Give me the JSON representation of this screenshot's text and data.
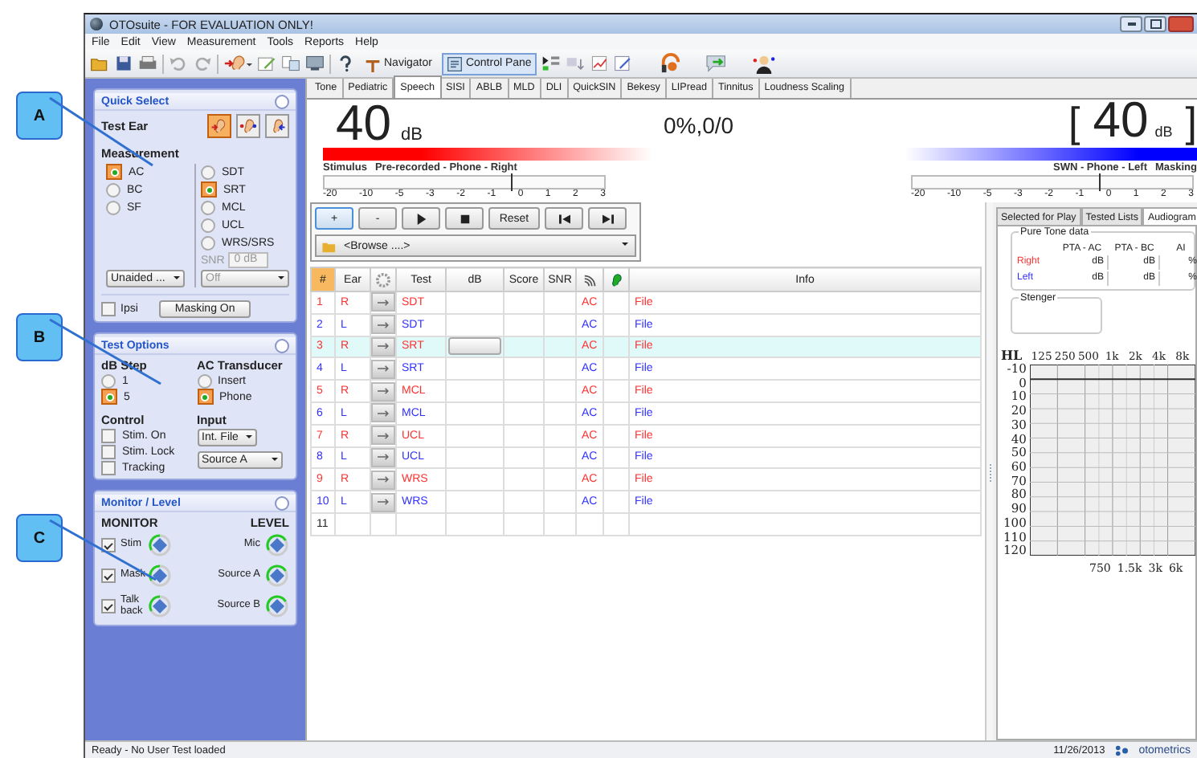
{
  "window": {
    "title": "OTOsuite - FOR EVALUATION ONLY!"
  },
  "menu": [
    "File",
    "Edit",
    "View",
    "Measurement",
    "Tools",
    "Reports",
    "Help"
  ],
  "toolbar": {
    "navigator": "Navigator",
    "control_panel": "Control Pane"
  },
  "callouts": [
    {
      "label": "A"
    },
    {
      "label": "B"
    },
    {
      "label": "C"
    }
  ],
  "quick_select": {
    "title": "Quick Select",
    "test_ear_label": "Test Ear",
    "ear_buttons": [
      {
        "kind": "right",
        "selected": true
      },
      {
        "kind": "both",
        "selected": false
      },
      {
        "kind": "left",
        "selected": false
      }
    ],
    "measurement_label": "Measurement",
    "transducers": [
      {
        "label": "AC",
        "selected": true
      },
      {
        "label": "BC",
        "selected": false
      },
      {
        "label": "SF",
        "selected": false
      }
    ],
    "tests": [
      {
        "label": "SDT",
        "selected": false
      },
      {
        "label": "SRT",
        "selected": true
      },
      {
        "label": "MCL",
        "selected": false
      },
      {
        "label": "UCL",
        "selected": false
      },
      {
        "label": "WRS/SRS",
        "selected": false
      }
    ],
    "snr_label": "SNR",
    "snr_value": "0 dB",
    "snr_mode": "Off",
    "aided": "Unaided ...",
    "ipsi": {
      "label": "Ipsi",
      "checked": false
    },
    "masking_button": "Masking On"
  },
  "test_options": {
    "title": "Test Options",
    "db_step_label": "dB Step",
    "db_steps": [
      {
        "label": "1",
        "selected": false
      },
      {
        "label": "5",
        "selected": true
      }
    ],
    "transducer_label": "AC Transducer",
    "transducers": [
      {
        "label": "Insert",
        "selected": false
      },
      {
        "label": "Phone",
        "selected": true
      }
    ],
    "control_label": "Control",
    "controls": [
      {
        "label": "Stim. On",
        "checked": false
      },
      {
        "label": "Stim. Lock",
        "checked": false
      },
      {
        "label": "Tracking",
        "checked": false
      }
    ],
    "input_label": "Input",
    "input_source": "Int. File",
    "input_channel": "Source A"
  },
  "monitor": {
    "title": "Monitor / Level",
    "monitor_label": "MONITOR",
    "level_label": "LEVEL",
    "monitors": [
      {
        "label": "Stim",
        "checked": true
      },
      {
        "label": "Mask",
        "checked": true
      },
      {
        "label": "Talk back",
        "checked": true
      }
    ],
    "levels": [
      "Mic",
      "Source A",
      "Source B"
    ]
  },
  "test_tabs": [
    {
      "label": "Tone",
      "selected": false
    },
    {
      "label": "Pediatric",
      "selected": false
    },
    {
      "label": "Speech",
      "selected": true
    },
    {
      "label": "SISI",
      "selected": false
    },
    {
      "label": "ABLB",
      "selected": false
    },
    {
      "label": "MLD",
      "selected": false
    },
    {
      "label": "DLI",
      "selected": false
    },
    {
      "label": "QuickSIN",
      "selected": false
    },
    {
      "label": "Bekesy",
      "selected": false
    },
    {
      "label": "LIPread",
      "selected": false
    },
    {
      "label": "Tinnitus",
      "selected": false
    },
    {
      "label": "Loudness Scaling",
      "selected": false
    }
  ],
  "display": {
    "stimulus_level": "40",
    "stimulus_unit": "dB",
    "score": "0%,0/0",
    "bracket_open": "[",
    "masking_level": "40",
    "masking_unit": "dB",
    "bracket_close": "]",
    "stimulus_title": "Stimulus",
    "stimulus_desc": "Pre-recorded - Phone - Right",
    "masking_desc": "SWN - Phone - Left",
    "masking_title": "Masking",
    "stimulus_slider": {
      "level": 0.667
    },
    "masking_slider": {
      "level": 0.667
    },
    "stimulus_scale": [
      "-20",
      "-10",
      "-5",
      "-3",
      "-2",
      "-1",
      "0",
      "1",
      "2",
      "3"
    ],
    "masking_scale": [
      "-20",
      "-10",
      "-5",
      "-3",
      "-2",
      "-1",
      "0",
      "1",
      "2",
      "3"
    ]
  },
  "player": {
    "buttons": [
      {
        "kind": "text",
        "label": "+"
      },
      {
        "kind": "text",
        "label": "-"
      },
      {
        "kind": "play"
      },
      {
        "kind": "stop"
      },
      {
        "kind": "text",
        "label": "Reset"
      },
      {
        "kind": "previous"
      },
      {
        "kind": "next"
      }
    ],
    "browse": "<Browse ....>"
  },
  "table": {
    "columns": [
      {
        "kind": "text",
        "label": "#"
      },
      {
        "kind": "text",
        "label": "Ear"
      },
      {
        "kind": "gear"
      },
      {
        "kind": "text",
        "label": "Test"
      },
      {
        "kind": "text",
        "label": "dB"
      },
      {
        "kind": "text",
        "label": "Score"
      },
      {
        "kind": "text",
        "label": "SNR"
      },
      {
        "kind": "waves"
      },
      {
        "kind": "ear"
      },
      {
        "kind": "text",
        "label": "Info"
      }
    ],
    "rows": [
      {
        "number": "1",
        "ear": "R",
        "test": "SDT",
        "transducer": "AC",
        "info": "File",
        "color": "#ff3030",
        "selected": false
      },
      {
        "number": "2",
        "ear": "L",
        "test": "SDT",
        "transducer": "AC",
        "info": "File",
        "color": "#3030ff",
        "selected": false
      },
      {
        "number": "3",
        "ear": "R",
        "test": "SRT",
        "transducer": "AC",
        "info": "File",
        "color": "#ff3030",
        "selected": true
      },
      {
        "number": "4",
        "ear": "L",
        "test": "SRT",
        "transducer": "AC",
        "info": "File",
        "color": "#3030ff",
        "selected": false
      },
      {
        "number": "5",
        "ear": "R",
        "test": "MCL",
        "transducer": "AC",
        "info": "File",
        "color": "#ff3030",
        "selected": false
      },
      {
        "number": "6",
        "ear": "L",
        "test": "MCL",
        "transducer": "AC",
        "info": "File",
        "color": "#3030ff",
        "selected": false
      },
      {
        "number": "7",
        "ear": "R",
        "test": "UCL",
        "transducer": "AC",
        "info": "File",
        "color": "#ff3030",
        "selected": false
      },
      {
        "number": "8",
        "ear": "L",
        "test": "UCL",
        "transducer": "AC",
        "info": "File",
        "color": "#3030ff",
        "selected": false
      },
      {
        "number": "9",
        "ear": "R",
        "test": "WRS",
        "transducer": "AC",
        "info": "File",
        "color": "#ff3030",
        "selected": false
      },
      {
        "number": "10",
        "ear": "L",
        "test": "WRS",
        "transducer": "AC",
        "info": "File",
        "color": "#3030ff",
        "selected": false
      }
    ],
    "empty_row_number": "11"
  },
  "side_tabs": [
    {
      "label": "Selected for Play",
      "selected": false
    },
    {
      "label": "Tested Lists",
      "selected": false
    },
    {
      "label": "Audiogram",
      "selected": true
    }
  ],
  "pure_tone": {
    "title": "Pure Tone data",
    "columns": [
      "PTA - AC",
      "PTA - BC",
      "AI"
    ],
    "rows": [
      {
        "label": "Right",
        "color": "#ff3030",
        "values": [
          "dB",
          "dB",
          "%"
        ]
      },
      {
        "label": "Left",
        "color": "#3030ff",
        "values": [
          "dB",
          "dB",
          "%"
        ]
      }
    ]
  },
  "stenger": {
    "title": "Stenger"
  },
  "audiogram": {
    "y_unit": "HL",
    "top_freqs": [
      "125",
      "250",
      "500",
      "1k",
      "2k",
      "4k",
      "8k"
    ],
    "bottom_freqs": [
      "750",
      "1.5k",
      "3k",
      "6k"
    ],
    "y_ticks": [
      "-10",
      "0",
      "10",
      "20",
      "30",
      "40",
      "50",
      "60",
      "70",
      "80",
      "90",
      "100",
      "110",
      "120"
    ]
  },
  "status_bar": {
    "message": "Ready - No User Test loaded",
    "date": "11/26/2013",
    "brand": "otometrics"
  }
}
